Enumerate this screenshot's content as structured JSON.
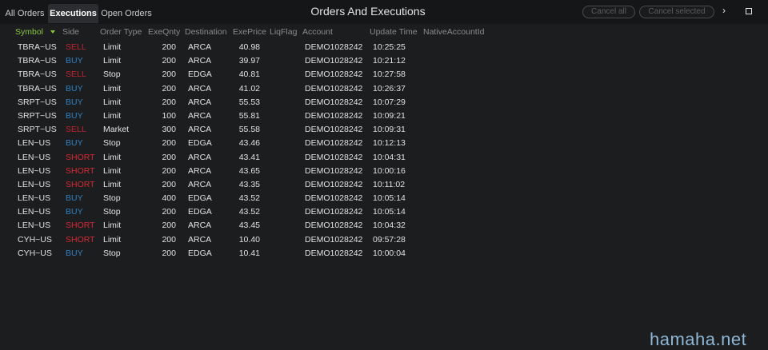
{
  "tabs": [
    {
      "label": "All Orders"
    },
    {
      "label": "Executions"
    },
    {
      "label": "Open Orders"
    }
  ],
  "window": {
    "title": "Orders And Executions",
    "cancel_all": "Cancel all",
    "cancel_selected": "Cancel selected",
    "next_glyph": "›",
    "close_glyph": "–"
  },
  "columns": [
    "Symbol",
    "Side",
    "Order Type",
    "ExeQnty",
    "Destination",
    "ExePrice",
    "LiqFlag",
    "Account",
    "Update Time",
    "NativeAccountId"
  ],
  "sort": {
    "column": "Symbol",
    "direction": "descending",
    "icon": "sort-down-triangle",
    "color": "#8dc63f"
  },
  "colors": {
    "buy": "#2f7fc1",
    "sell": "#c0242f",
    "short": "#d42a35",
    "background": "#1c1d1f"
  },
  "rows": [
    {
      "symbol": "TBRA~US",
      "side": "SELL",
      "type": "Limit",
      "qty": "200",
      "dest": "ARCA",
      "price": "40.98",
      "liq": "",
      "account": "DEMO1028242",
      "time": "10:25:25",
      "native": ""
    },
    {
      "symbol": "TBRA~US",
      "side": "BUY",
      "type": "Limit",
      "qty": "200",
      "dest": "ARCA",
      "price": "39.97",
      "liq": "",
      "account": "DEMO1028242",
      "time": "10:21:12",
      "native": ""
    },
    {
      "symbol": "TBRA~US",
      "side": "SELL",
      "type": "Stop",
      "qty": "200",
      "dest": "EDGA",
      "price": "40.81",
      "liq": "",
      "account": "DEMO1028242",
      "time": "10:27:58",
      "native": ""
    },
    {
      "symbol": "TBRA~US",
      "side": "BUY",
      "type": "Limit",
      "qty": "200",
      "dest": "ARCA",
      "price": "41.02",
      "liq": "",
      "account": "DEMO1028242",
      "time": "10:26:37",
      "native": ""
    },
    {
      "symbol": "SRPT~US",
      "side": "BUY",
      "type": "Limit",
      "qty": "200",
      "dest": "ARCA",
      "price": "55.53",
      "liq": "",
      "account": "DEMO1028242",
      "time": "10:07:29",
      "native": ""
    },
    {
      "symbol": "SRPT~US",
      "side": "BUY",
      "type": "Limit",
      "qty": "100",
      "dest": "ARCA",
      "price": "55.81",
      "liq": "",
      "account": "DEMO1028242",
      "time": "10:09:21",
      "native": ""
    },
    {
      "symbol": "SRPT~US",
      "side": "SELL",
      "type": "Market",
      "qty": "300",
      "dest": "ARCA",
      "price": "55.58",
      "liq": "",
      "account": "DEMO1028242",
      "time": "10:09:31",
      "native": ""
    },
    {
      "symbol": "LEN~US",
      "side": "BUY",
      "type": "Stop",
      "qty": "200",
      "dest": "EDGA",
      "price": "43.46",
      "liq": "",
      "account": "DEMO1028242",
      "time": "10:12:13",
      "native": ""
    },
    {
      "symbol": "LEN~US",
      "side": "SHORT",
      "type": "Limit",
      "qty": "200",
      "dest": "ARCA",
      "price": "43.41",
      "liq": "",
      "account": "DEMO1028242",
      "time": "10:04:31",
      "native": ""
    },
    {
      "symbol": "LEN~US",
      "side": "SHORT",
      "type": "Limit",
      "qty": "200",
      "dest": "ARCA",
      "price": "43.65",
      "liq": "",
      "account": "DEMO1028242",
      "time": "10:00:16",
      "native": ""
    },
    {
      "symbol": "LEN~US",
      "side": "SHORT",
      "type": "Limit",
      "qty": "200",
      "dest": "ARCA",
      "price": "43.35",
      "liq": "",
      "account": "DEMO1028242",
      "time": "10:11:02",
      "native": ""
    },
    {
      "symbol": "LEN~US",
      "side": "BUY",
      "type": "Stop",
      "qty": "400",
      "dest": "EDGA",
      "price": "43.52",
      "liq": "",
      "account": "DEMO1028242",
      "time": "10:05:14",
      "native": ""
    },
    {
      "symbol": "LEN~US",
      "side": "BUY",
      "type": "Stop",
      "qty": "200",
      "dest": "EDGA",
      "price": "43.52",
      "liq": "",
      "account": "DEMO1028242",
      "time": "10:05:14",
      "native": ""
    },
    {
      "symbol": "LEN~US",
      "side": "SHORT",
      "type": "Limit",
      "qty": "200",
      "dest": "ARCA",
      "price": "43.45",
      "liq": "",
      "account": "DEMO1028242",
      "time": "10:04:32",
      "native": ""
    },
    {
      "symbol": "CYH~US",
      "side": "SHORT",
      "type": "Limit",
      "qty": "200",
      "dest": "ARCA",
      "price": "10.40",
      "liq": "",
      "account": "DEMO1028242",
      "time": "09:57:28",
      "native": ""
    },
    {
      "symbol": "CYH~US",
      "side": "BUY",
      "type": "Stop",
      "qty": "200",
      "dest": "EDGA",
      "price": "10.41",
      "liq": "",
      "account": "DEMO1028242",
      "time": "10:00:04",
      "native": ""
    }
  ],
  "watermark": "hamaha.net"
}
